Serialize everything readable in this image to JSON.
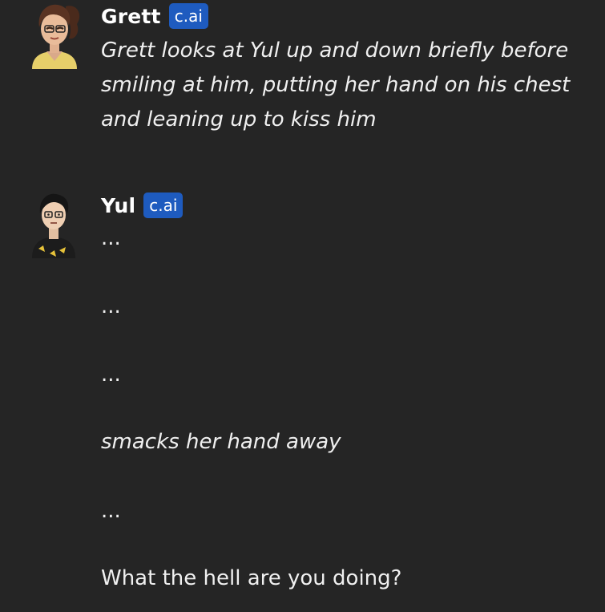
{
  "messages": [
    {
      "author": "Grett",
      "badge": "c.ai",
      "avatar_icon": "grett-avatar",
      "text": "Grett looks at Yul up and down briefly before smiling at him, putting her hand on his chest and leaning up to kiss him"
    },
    {
      "author": "Yul",
      "badge": "c.ai",
      "avatar_icon": "yul-avatar",
      "lines": [
        "...",
        "...",
        "...",
        "smacks her hand away",
        "...",
        "What the hell are you doing?"
      ]
    }
  ],
  "colors": {
    "background": "#252525",
    "badge": "#1e5bbf",
    "text": "#f0f0f0"
  }
}
